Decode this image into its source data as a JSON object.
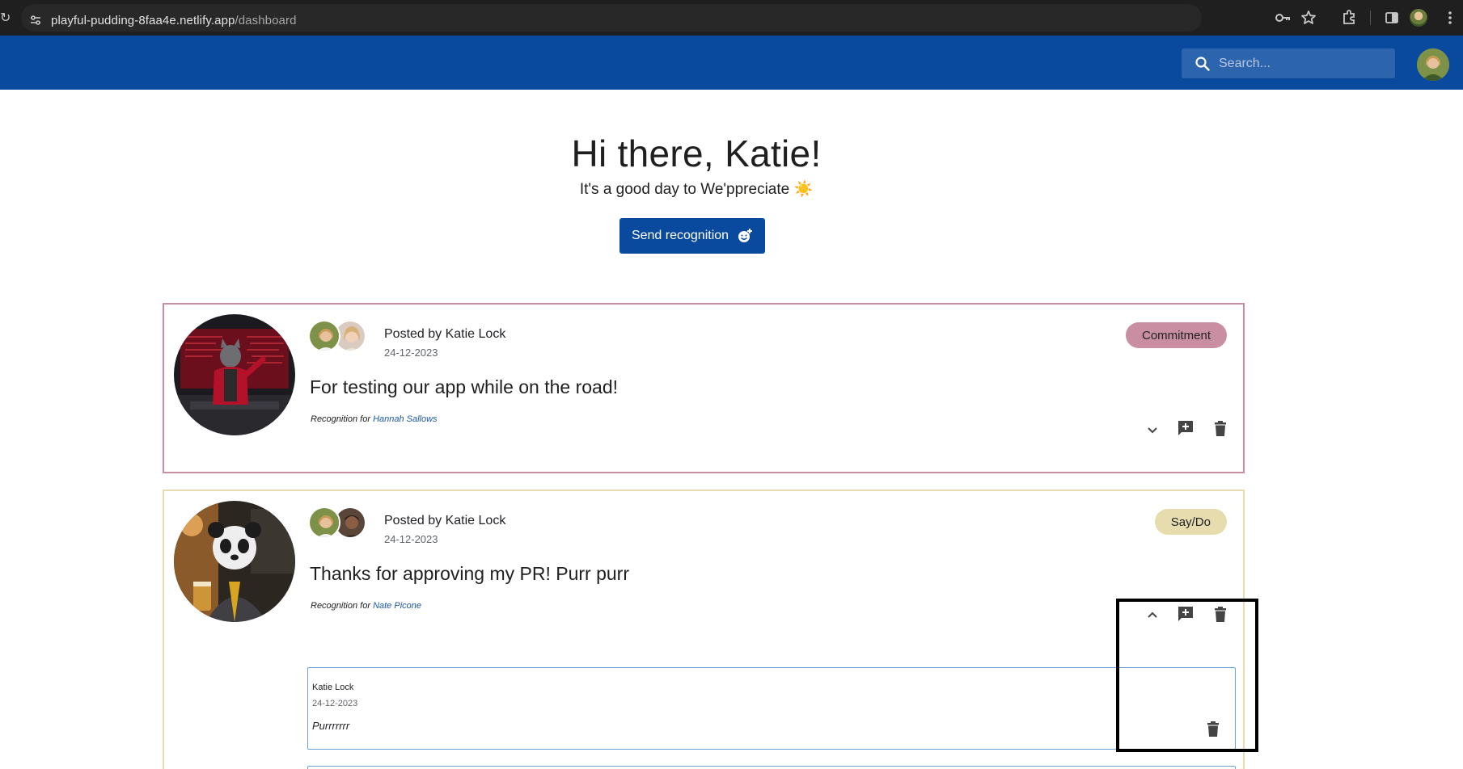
{
  "browser": {
    "url_domain": "playful-pudding-8faa4e.netlify.app",
    "url_path": "/dashboard",
    "icons": [
      "key-icon",
      "star-icon",
      "extensions-icon",
      "side-panel-icon",
      "profile-icon",
      "more-vert-icon"
    ]
  },
  "header": {
    "search_placeholder": "Search...",
    "color": "#0a4a9e"
  },
  "hero": {
    "greeting": "Hi there, Katie!",
    "subtitle": "It's a good day to We'ppreciate ☀️",
    "send_button_label": "Send recognition"
  },
  "posts": [
    {
      "posted_by": "Posted by Katie Lock",
      "date": "24-12-2023",
      "message": "For testing our app while on the road!",
      "recognition_prefix": "Recognition for",
      "recipient": "Hannah Sallows",
      "tag": "Commitment",
      "tag_color": "#c98ea2",
      "expanded": false
    },
    {
      "posted_by": "Posted by Katie Lock",
      "date": "24-12-2023",
      "message": "Thanks for approving my PR! Purr purr",
      "recognition_prefix": "Recognition for",
      "recipient": "Nate Picone",
      "tag": "Say/Do",
      "tag_color": "#e6dcae",
      "expanded": true,
      "comments": [
        {
          "author": "Katie Lock",
          "date": "24-12-2023",
          "text": "Purrrrrrr"
        }
      ]
    }
  ]
}
